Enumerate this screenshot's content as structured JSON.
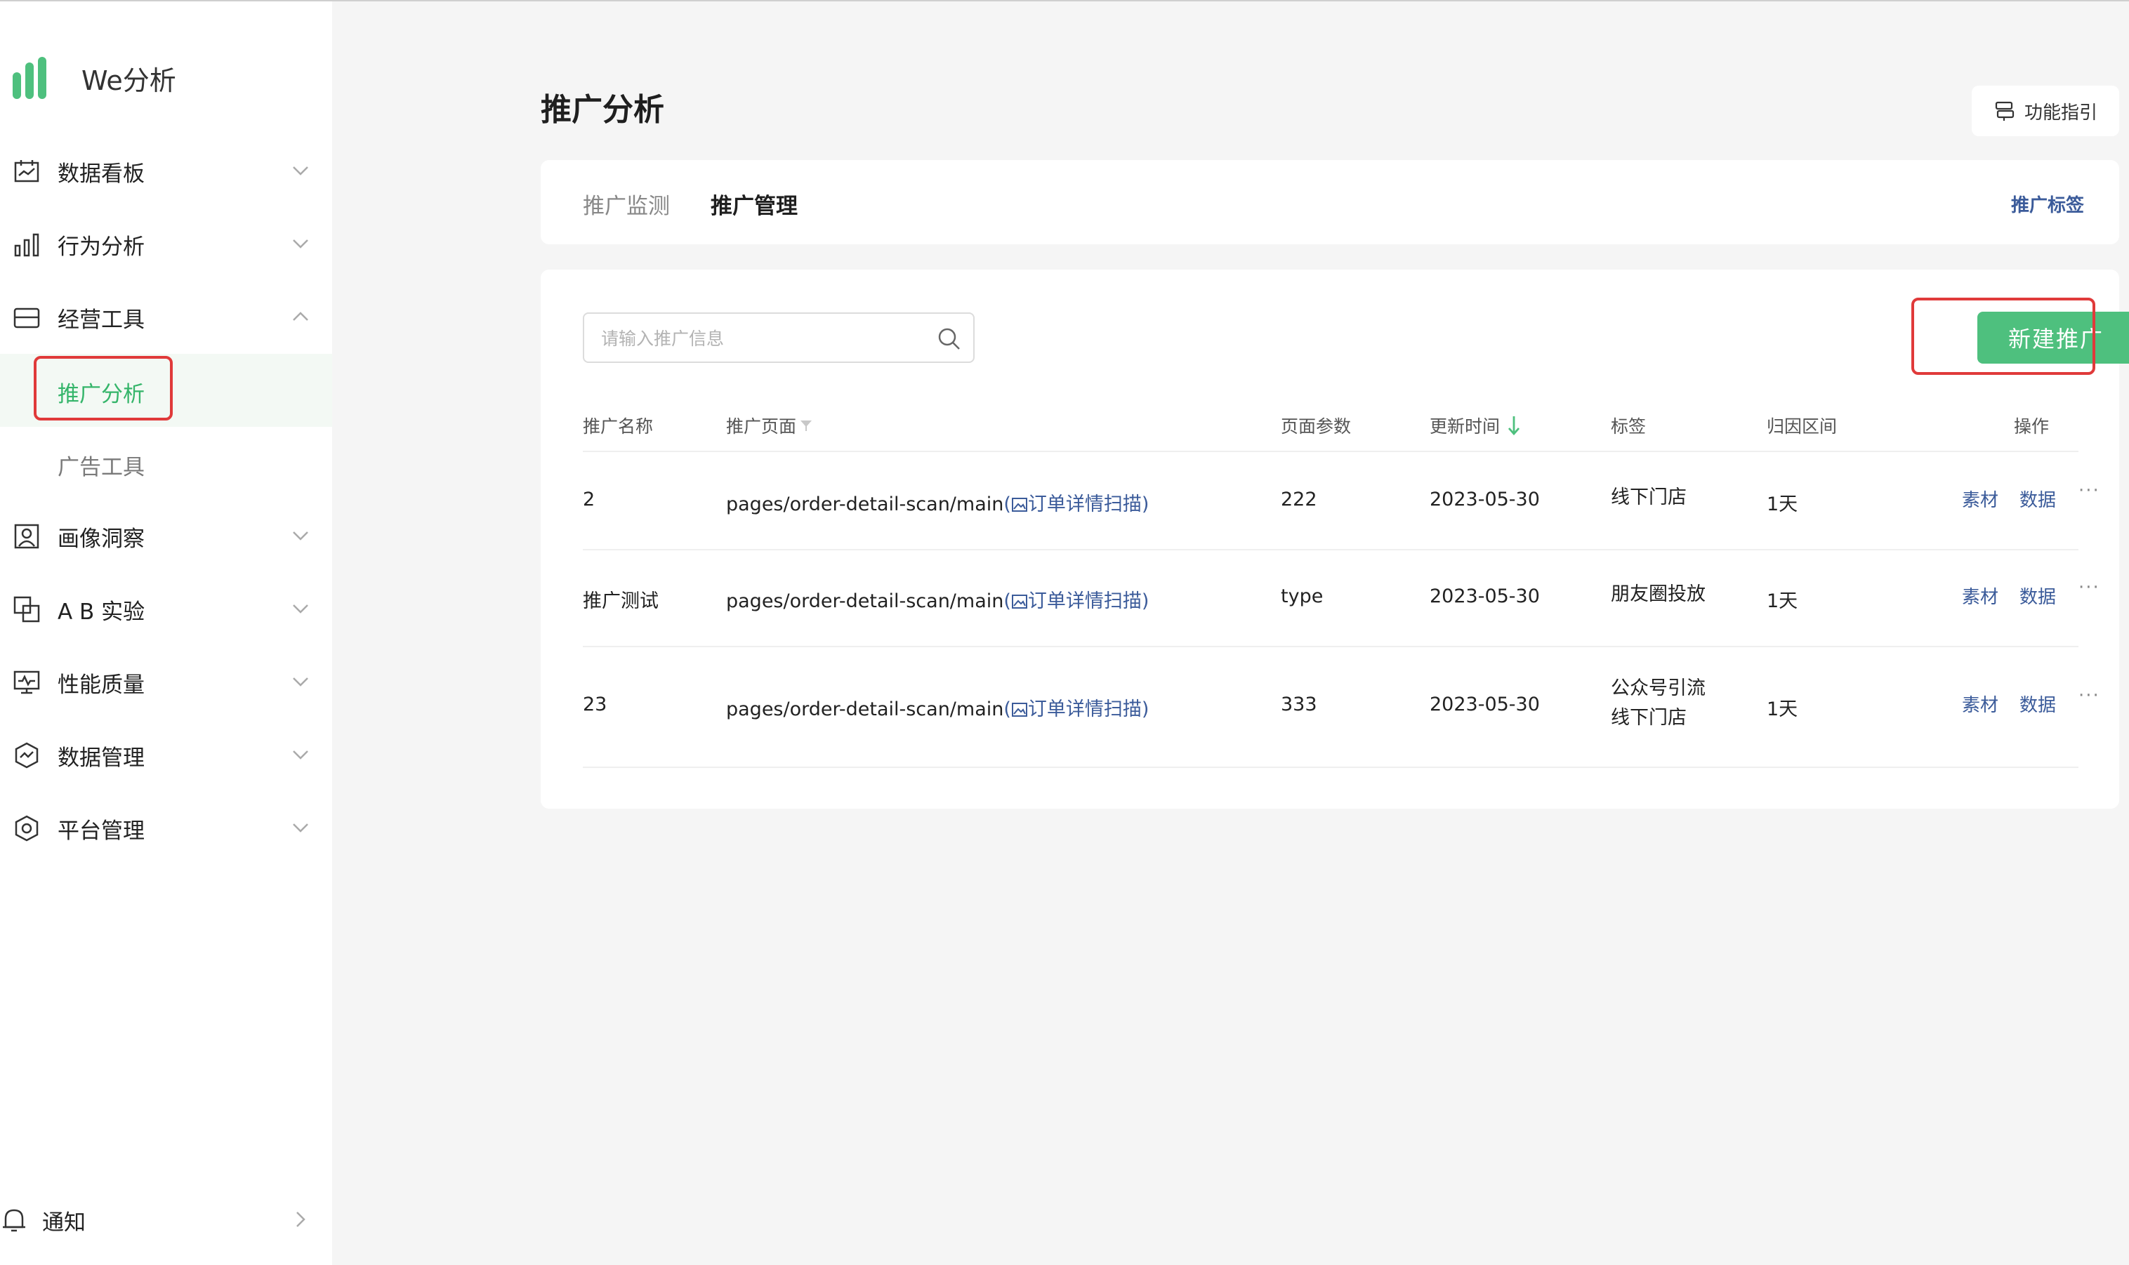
{
  "app": {
    "name": "We分析"
  },
  "sidebar": {
    "items": [
      {
        "label": "数据看板",
        "icon": "calendar-chart-icon"
      },
      {
        "label": "行为分析",
        "icon": "bar-chart-icon"
      },
      {
        "label": "经营工具",
        "icon": "tray-icon"
      },
      {
        "label": "画像洞察",
        "icon": "portrait-icon"
      },
      {
        "label": "A B 实验",
        "icon": "ab-test-icon"
      },
      {
        "label": "性能质量",
        "icon": "monitor-icon"
      },
      {
        "label": "数据管理",
        "icon": "data-shield-icon"
      },
      {
        "label": "平台管理",
        "icon": "hexagon-settings-icon"
      }
    ],
    "sub_items": [
      {
        "label": "推广分析",
        "active": true
      },
      {
        "label": "广告工具",
        "active": false
      }
    ],
    "notify": "通知"
  },
  "header": {
    "title": "推广分析",
    "guide_label": "功能指引"
  },
  "tabs": [
    {
      "label": "推广监测"
    },
    {
      "label": "推广管理"
    }
  ],
  "tab_link": "推广标签",
  "search": {
    "placeholder": "请输入推广信息"
  },
  "new_button": "新建推广",
  "table": {
    "columns": [
      "推广名称",
      "推广页面",
      "页面参数",
      "更新时间",
      "标签",
      "归因区间",
      "操作"
    ],
    "rows": [
      {
        "name": "2",
        "page": "pages/order-detail-scan/main",
        "page_name": "订单详情扫描",
        "param": "222",
        "updated": "2023-05-30",
        "tags": [
          "线下门店"
        ],
        "range": "1天"
      },
      {
        "name": "推广测试",
        "page": "pages/order-detail-scan/main",
        "page_name": "订单详情扫描",
        "param": "type",
        "updated": "2023-05-30",
        "tags": [
          "朋友圈投放"
        ],
        "range": "1天"
      },
      {
        "name": "23",
        "page": "pages/order-detail-scan/main",
        "page_name": "订单详情扫描",
        "param": "333",
        "updated": "2023-05-30",
        "tags": [
          "公众号引流",
          "线下门店"
        ],
        "range": "1天"
      }
    ],
    "actions": {
      "material": "素材",
      "data": "数据",
      "more": "···"
    }
  },
  "colors": {
    "accent": "#4ec07e",
    "link": "#3b5b9a",
    "highlight": "#e03a3a"
  }
}
